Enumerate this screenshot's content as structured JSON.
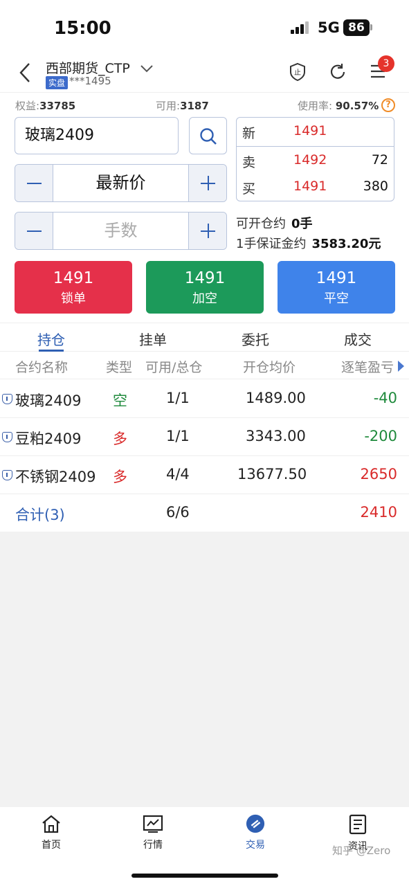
{
  "status_bar": {
    "time": "15:00",
    "network": "5G",
    "battery": "86"
  },
  "header": {
    "account_name": "西部期货_CTP",
    "account_type_badge": "实盘",
    "account_id": "***1495",
    "notification_count": "3",
    "icons": [
      "back-icon",
      "chevron-down-icon",
      "stop-loss-icon",
      "refresh-icon",
      "menu-icon"
    ]
  },
  "summary": {
    "equity_label": "权益:",
    "equity_value": "33785",
    "available_label": "可用:",
    "available_value": "3187",
    "usage_label": "使用率:",
    "usage_value": "90.57%",
    "help_label": "?"
  },
  "order": {
    "symbol": "玻璃2409",
    "price_type": "最新价",
    "quantity_placeholder": "手数"
  },
  "quote": {
    "last_label": "新",
    "last_price": "1491",
    "ask_label": "卖",
    "ask_price": "1492",
    "ask_volume": "72",
    "bid_label": "买",
    "bid_price": "1491",
    "bid_volume": "380"
  },
  "margin": {
    "openable_label": "可开仓约",
    "openable_value": "0手",
    "per_lot_label": "1手保证金约",
    "per_lot_value": "3583.20元"
  },
  "actions": [
    {
      "price": "1491",
      "label": "锁单"
    },
    {
      "price": "1491",
      "label": "加空"
    },
    {
      "price": "1491",
      "label": "平空"
    }
  ],
  "tabs": [
    "持仓",
    "挂单",
    "委托",
    "成交"
  ],
  "table": {
    "headers": [
      "合约名称",
      "类型",
      "可用/总仓",
      "开仓均价",
      "逐笔盈亏"
    ],
    "rows": [
      {
        "name": "玻璃2409",
        "type": "空",
        "position": "1/1",
        "avg_price": "1489.00",
        "pnl": "-40"
      },
      {
        "name": "豆粕2409",
        "type": "多",
        "position": "1/1",
        "avg_price": "3343.00",
        "pnl": "-200"
      },
      {
        "name": "不锈钢2409",
        "type": "多",
        "position": "4/4",
        "avg_price": "13677.50",
        "pnl": "2650"
      }
    ],
    "total": {
      "label": "合计(3)",
      "position": "6/6",
      "pnl": "2410"
    }
  },
  "bottom_nav": [
    {
      "label": "首页",
      "icon": "home-icon"
    },
    {
      "label": "行情",
      "icon": "chart-icon"
    },
    {
      "label": "交易",
      "icon": "trade-icon"
    },
    {
      "label": "资讯",
      "icon": "news-icon"
    }
  ],
  "watermark": "知乎 @Zero",
  "colors": {
    "accent": "#2f5fb3",
    "up": "#d92a2a",
    "down": "#1f8a3c",
    "lock_button": "#e5304a",
    "add_button": "#1c9a5a",
    "close_button": "#3f83ea"
  }
}
